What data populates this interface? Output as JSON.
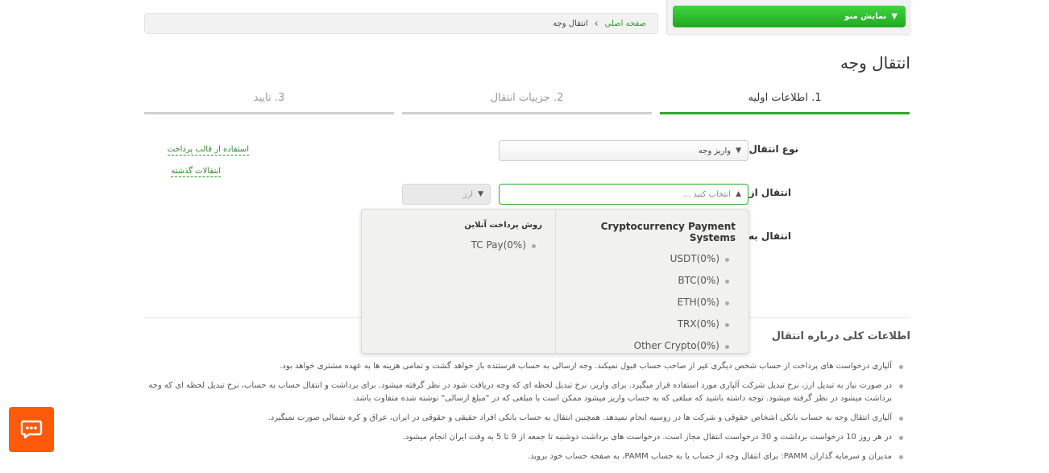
{
  "breadcrumb": {
    "home": "صفحه اصلی",
    "separator": "›",
    "current": "انتقال وجه"
  },
  "menu": {
    "button_label": "نمایش منو"
  },
  "page_title": "انتقال وجه",
  "steps": [
    {
      "label": "1. اطلاعات اولیه"
    },
    {
      "label": "2. جزییات انتقال"
    },
    {
      "label": "3. تایید"
    }
  ],
  "form": {
    "transfer_type_label": "نوع انتقال:",
    "transfer_type_value": "واریز وجه",
    "from_label": "انتقال از:",
    "from_placeholder": "انتخاب کنید ...",
    "currency_placeholder": "ارز",
    "to_label": "انتقال به:"
  },
  "links": {
    "use_template": "استفاده از قالب پرداخت",
    "past_transfers": "انتقالات گذشته"
  },
  "dropdown": {
    "right_header": "Cryptocurrency Payment Systems",
    "right_items": [
      "USDT(0%)",
      "BTC(0%)",
      "ETH(0%)",
      "TRX(0%)",
      "Other Crypto(0%)"
    ],
    "left_header": "روش پرداخت آنلاین",
    "left_items": [
      "TC Pay(0%)"
    ]
  },
  "info": {
    "title": "اطلاعات کلی درباره انتقال",
    "items": [
      "آلپاری درخواست های پرداخت از حساب شخص دیگری غیر از صاحب حساب قبول نمیکند. وجه ارسالی به حساب فرستنده باز خواهد گشت و تمامی هزینه ها به عهده مشتری خواهد بود.",
      "در صورت نیاز به تبدیل ارز، نرخ تبدیل شرکت آلپاری مورد استفاده قرار میگیرد. برای واریز، نرخ تبدیل لحظه ای که وجه دریافت شود در نظر گرفته میشود. برای برداشت و انتقال حساب به حساب، نرخ تبدیل لحظه ای که وجه برداشت میشود در نظر گرفته میشود. توجه داشته باشید که مبلغی که به حساب واریز میشود ممکن است با مبلغی که در \"مبلغ ارسالی\" نوشته شده متفاوت باشد.",
      "آلپاری انتقال وجه به حساب بانکی اشخاص حقوقی و شرکت ها در روسیه انجام نمیدهد. همچنین انتقال به حساب بانکی افراد حقیقی و حقوقی در ایران، عراق و کره شمالی صورت نمیگیرد.",
      "در هر روز 10 درخواست برداشت و 30 درخواست انتقال مجاز است. درخواست های برداشت دوشنبه تا جمعه از 9 تا 5 به وقت ایران انجام میشود.",
      "مدیران و سرمایه گذاران PAMM: برای انتقال وجه از حساب یا به حساب PAMM، به صفحه حساب خود بروید."
    ]
  },
  "colors": {
    "accent_green": "#2ea82e",
    "chat_orange": "#ff5a0a"
  }
}
